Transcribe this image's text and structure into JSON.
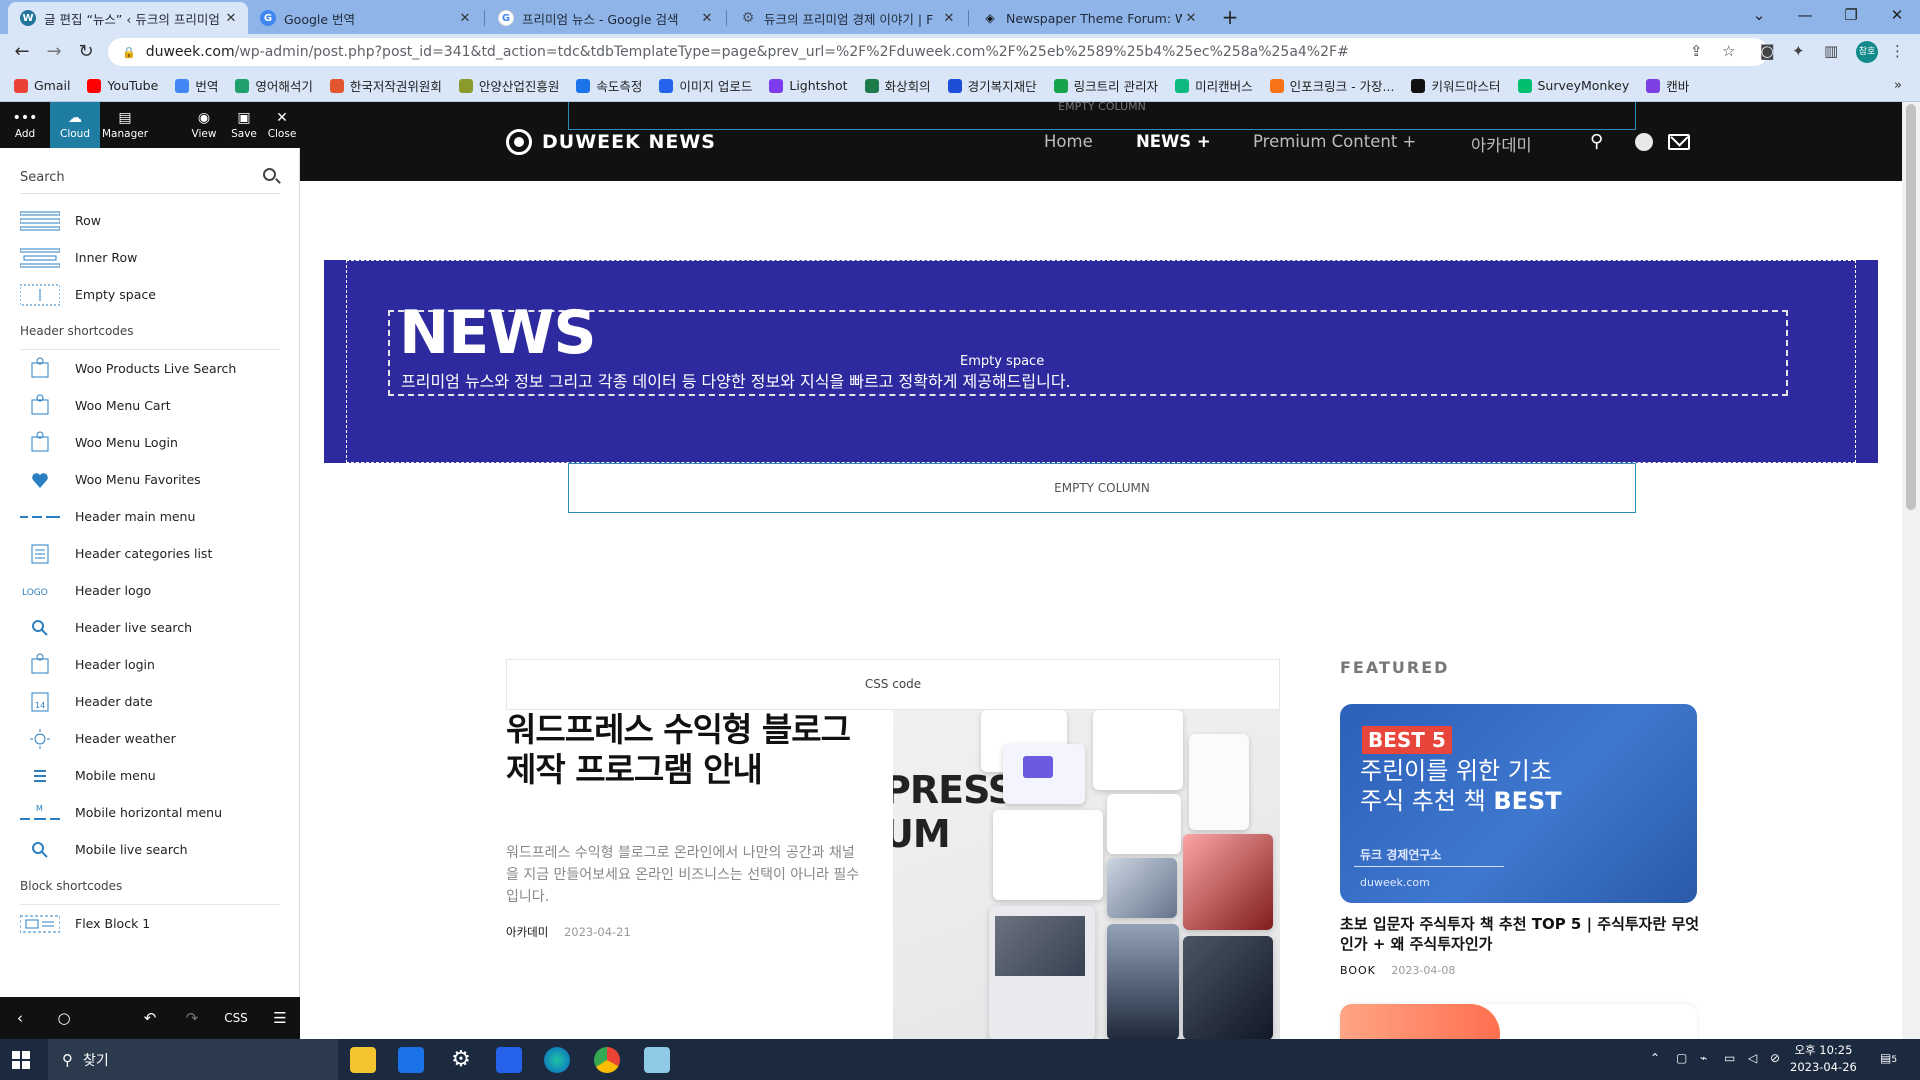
{
  "browser": {
    "tabs": [
      {
        "title": "글 편집 “뉴스” ‹ 듀크의 프리미엄",
        "favicon": "wordpress-icon",
        "color": "#21759b"
      },
      {
        "title": "Google 번역",
        "favicon": "google-translate-icon",
        "color": "#4285f4"
      },
      {
        "title": "프리미엄 뉴스 - Google 검색",
        "favicon": "google-icon",
        "color": "#ea4335"
      },
      {
        "title": "듀크의 프리미엄 경제 이야기 | F",
        "favicon": "gear-icon",
        "color": "#6b7280"
      },
      {
        "title": "Newspaper Theme Forum: Welc",
        "favicon": "tagdiv-icon",
        "color": "#111111"
      }
    ],
    "new_tab": "+",
    "url_domain": "duweek.com",
    "url_rest": "/wp-admin/post.php?post_id=341&td_action=tdc&tdbTemplateType=page&prev_url=%2F%2Fduweek.com%2F%25eb%2589%25b4%25ec%258a%25a4%2F#",
    "profile_initials": "참호",
    "bookmarks": [
      {
        "label": "Gmail",
        "color": "#ea4335"
      },
      {
        "label": "YouTube",
        "color": "#ff0000"
      },
      {
        "label": "번역",
        "color": "#4285f4"
      },
      {
        "label": "영어해석기",
        "color": "#22a06b"
      },
      {
        "label": "한국저작권위원회",
        "color": "#e4572e"
      },
      {
        "label": "안양산업진흥원",
        "color": "#8a9a2b"
      },
      {
        "label": "속도측정",
        "color": "#1a73e8"
      },
      {
        "label": "이미지 업로드",
        "color": "#2563eb"
      },
      {
        "label": "Lightshot",
        "color": "#7c3aed"
      },
      {
        "label": "화상회의",
        "color": "#1e7a4a"
      },
      {
        "label": "경기복지재단",
        "color": "#1d4ed8"
      },
      {
        "label": "링크트리 관리자",
        "color": "#16a34a"
      },
      {
        "label": "미리캔버스",
        "color": "#10b981"
      },
      {
        "label": "인포크링크 - 가장...",
        "color": "#f97316"
      },
      {
        "label": "키워드마스터",
        "color": "#111111"
      },
      {
        "label": "SurveyMonkey",
        "color": "#00bf6f"
      },
      {
        "label": "캔바",
        "color": "#7b3fe4"
      }
    ]
  },
  "composer": {
    "top_buttons": [
      "Add",
      "Cloud",
      "Manager",
      "View",
      "Save",
      "Close"
    ],
    "search_placeholder": "Search",
    "items": [
      {
        "label": "Row",
        "icon": "row-icon"
      },
      {
        "label": "Inner Row",
        "icon": "inner-row-icon"
      },
      {
        "label": "Empty space",
        "icon": "empty-space-icon"
      }
    ],
    "header_section": "Header shortcodes",
    "header_items": [
      {
        "label": "Woo Products Live Search",
        "icon": "woo-search-icon"
      },
      {
        "label": "Woo Menu Cart",
        "icon": "cart-icon"
      },
      {
        "label": "Woo Menu Login",
        "icon": "login-icon"
      },
      {
        "label": "Woo Menu Favorites",
        "icon": "heart-icon"
      },
      {
        "label": "Header main menu",
        "icon": "menu-icon"
      },
      {
        "label": "Header categories list",
        "icon": "list-icon"
      },
      {
        "label": "Header logo",
        "icon": "logo-icon"
      },
      {
        "label": "Header live search",
        "icon": "search-icon"
      },
      {
        "label": "Header login",
        "icon": "login-icon"
      },
      {
        "label": "Header date",
        "icon": "calendar-icon"
      },
      {
        "label": "Header weather",
        "icon": "sun-icon"
      },
      {
        "label": "Mobile menu",
        "icon": "hamburger-icon"
      },
      {
        "label": "Mobile horizontal menu",
        "icon": "horizontal-menu-icon"
      },
      {
        "label": "Mobile live search",
        "icon": "search-icon"
      }
    ],
    "block_section": "Block shortcodes",
    "block_items": [
      {
        "label": "Flex Block 1",
        "icon": "flex-block-icon"
      }
    ],
    "bottom_css": "CSS"
  },
  "page": {
    "site_name": "DUWEEK NEWS",
    "menu": [
      "Home",
      "NEWS",
      "Premium Content",
      "아카데미"
    ],
    "empty_column": "EMPTY COLUMN",
    "banner": {
      "title": "NEWS",
      "subtitle": "프리미엄 뉴스와 정보 그리고 각종 데이터 등 다양한 정보와 지식을 빠르고 정확하게 제공해드립니다.",
      "empty_space": "Empty space",
      "color": "#2d2a9f"
    },
    "css_code": "CSS code",
    "post": {
      "title": "워드프레스 수익형 블로그 제작 프로그램 안내",
      "excerpt": "워드프레스 수익형 블로그로 온라인에서 나만의 공간과 채널을 지금 만들어보세요 온라인 비즈니스는 선택이 아니라 필수입니다.",
      "category": "아카데미",
      "date": "2023-04-21",
      "image_text": "PRESS\nUM"
    },
    "featured": {
      "heading": "FEATURED",
      "image": {
        "badge": "BEST 5",
        "line1": "주린이를 위한 기초",
        "line2": "주식 추천 책",
        "line2_bold": "BEST",
        "org": "듀크 경제연구소",
        "site": "duweek.com"
      },
      "title": "초보 입문자 주식투자 책 추천 TOP 5 | 주식투자란 무엇인가 + 왜 주식투자인가",
      "category": "BOOK",
      "date": "2023-04-08"
    }
  },
  "taskbar": {
    "search_placeholder": "찾기",
    "time": "오후 10:25",
    "date": "2023-04-26",
    "notification_count": "5"
  }
}
